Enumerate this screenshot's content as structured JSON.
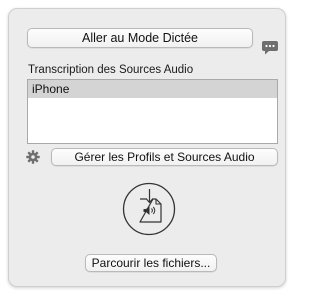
{
  "dictation_button_label": "Aller au Mode Dictée",
  "transcription": {
    "section_label": "Transcription des Sources Audio",
    "sources": [
      "iPhone"
    ]
  },
  "manage_button_label": "Gérer les Profils et Sources Audio",
  "browse_button_label": "Parcourir les fichiers...",
  "icons": {
    "speech": "speech-bubble-icon",
    "gear": "gear-icon",
    "audio_file": "audio-file-drop-icon"
  },
  "colors": {
    "panel_background": "#ececec",
    "list_selection": "#d4d4d4",
    "icon_gray": "#6e6e6e"
  }
}
